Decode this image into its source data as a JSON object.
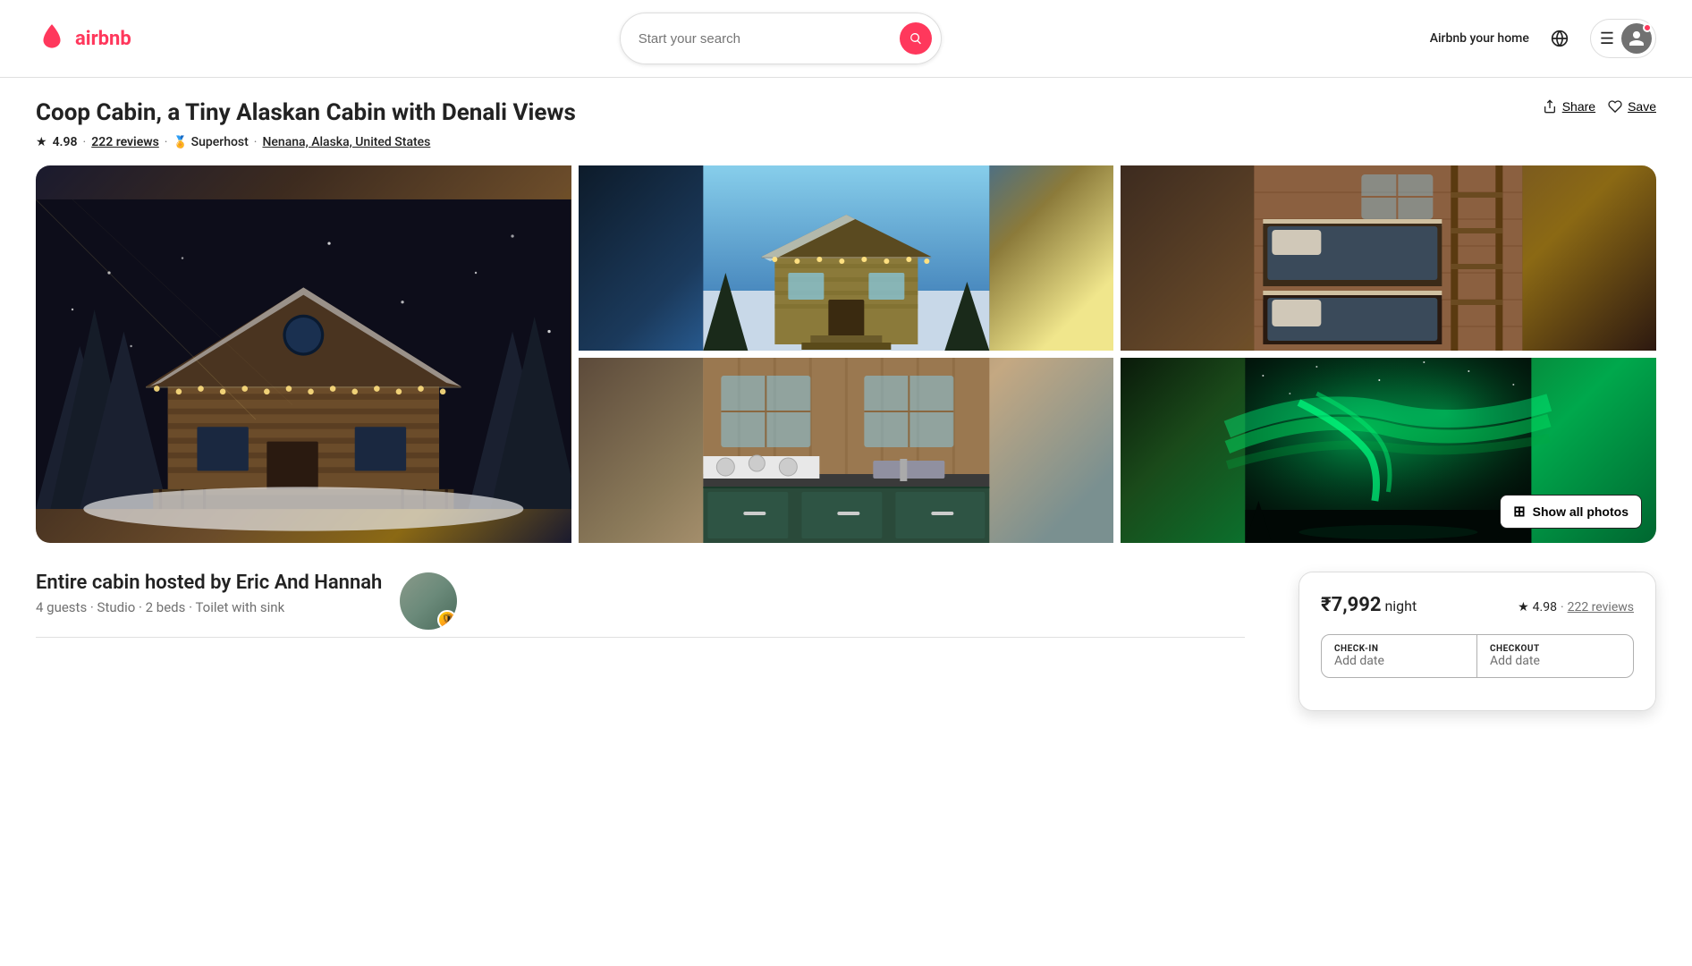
{
  "header": {
    "logo_text": "airbnb",
    "search_placeholder": "Start your search",
    "airbnb_home_label": "Airbnb your home",
    "user_menu_aria": "User menu"
  },
  "listing": {
    "title": "Coop Cabin, a Tiny Alaskan Cabin with Denali Views",
    "rating": "4.98",
    "reviews_count": "222 reviews",
    "superhost_label": "Superhost",
    "location": "Nenana, Alaska, United States",
    "share_label": "Share",
    "save_label": "Save",
    "show_all_photos_label": "Show all photos",
    "host_title": "Entire cabin hosted by Eric And Hannah",
    "host_details": "4 guests · Studio · 2 beds · Toilet with sink"
  },
  "booking": {
    "price": "₹7,992",
    "per_night": "night",
    "rating": "4.98",
    "reviews_link": "222 reviews",
    "checkin_label": "CHECK-IN",
    "checkin_placeholder": "Add date",
    "checkout_label": "CHECKOUT",
    "checkout_placeholder": "Add date"
  }
}
